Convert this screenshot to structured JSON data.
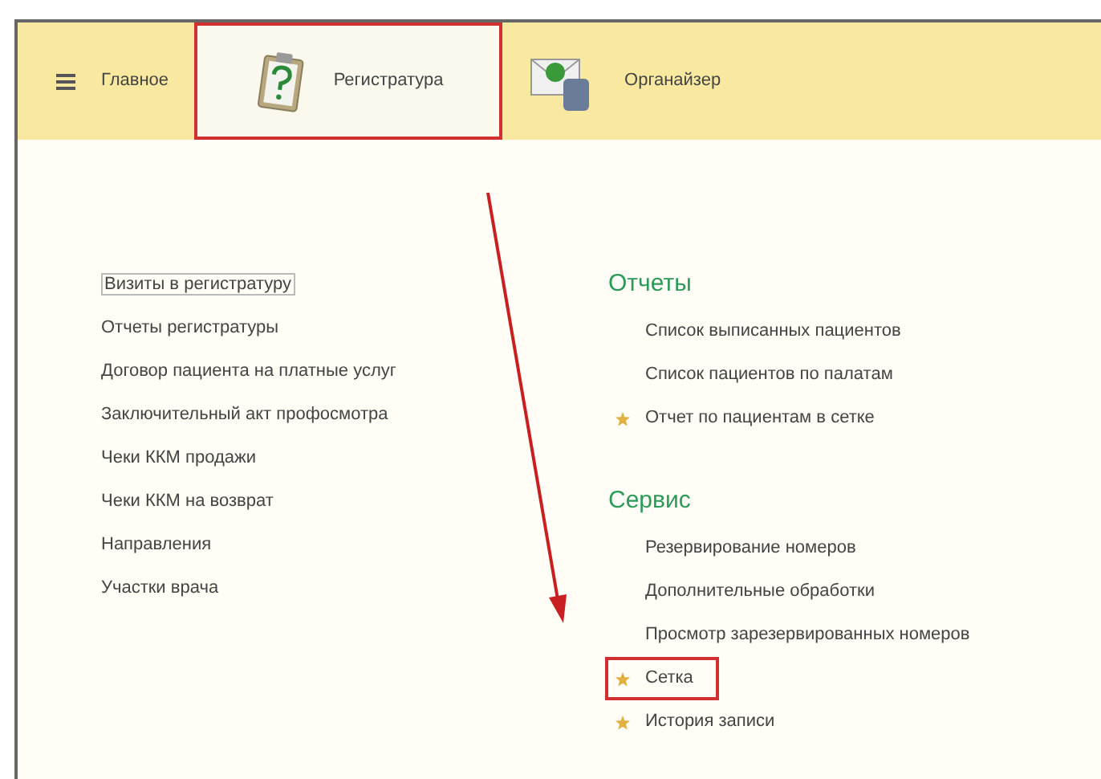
{
  "tabs": [
    {
      "label": "Главное",
      "kind": "menu",
      "selected": false
    },
    {
      "label": "Регистратура",
      "kind": "clipboard",
      "selected": true
    },
    {
      "label": "Органайзер",
      "kind": "mail",
      "selected": false
    }
  ],
  "left_items": [
    {
      "label": "Визиты в регистратуру",
      "selected": true
    },
    {
      "label": "Отчеты регистратуры",
      "selected": false
    },
    {
      "label": "Договор пациента на платные услуг",
      "selected": false
    },
    {
      "label": "Заключительный акт профосмотра",
      "selected": false
    },
    {
      "label": "Чеки ККМ продажи",
      "selected": false
    },
    {
      "label": "Чеки ККМ на возврат",
      "selected": false
    },
    {
      "label": "Направления",
      "selected": false
    },
    {
      "label": "Участки врача",
      "selected": false
    }
  ],
  "sections": [
    {
      "title": "Отчеты",
      "items": [
        {
          "label": "Список выписанных пациентов",
          "starred": false,
          "highlighted": false
        },
        {
          "label": "Список пациентов по палатам",
          "starred": false,
          "highlighted": false
        },
        {
          "label": "Отчет по пациентам в сетке",
          "starred": true,
          "highlighted": false
        }
      ]
    },
    {
      "title": "Сервис",
      "items": [
        {
          "label": "Резервирование номеров",
          "starred": false,
          "highlighted": false
        },
        {
          "label": "Дополнительные обработки",
          "starred": false,
          "highlighted": false
        },
        {
          "label": "Просмотр зарезервированных номеров",
          "starred": false,
          "highlighted": false
        },
        {
          "label": "Сетка",
          "starred": true,
          "highlighted": true
        },
        {
          "label": "История записи",
          "starred": true,
          "highlighted": false
        }
      ]
    }
  ]
}
